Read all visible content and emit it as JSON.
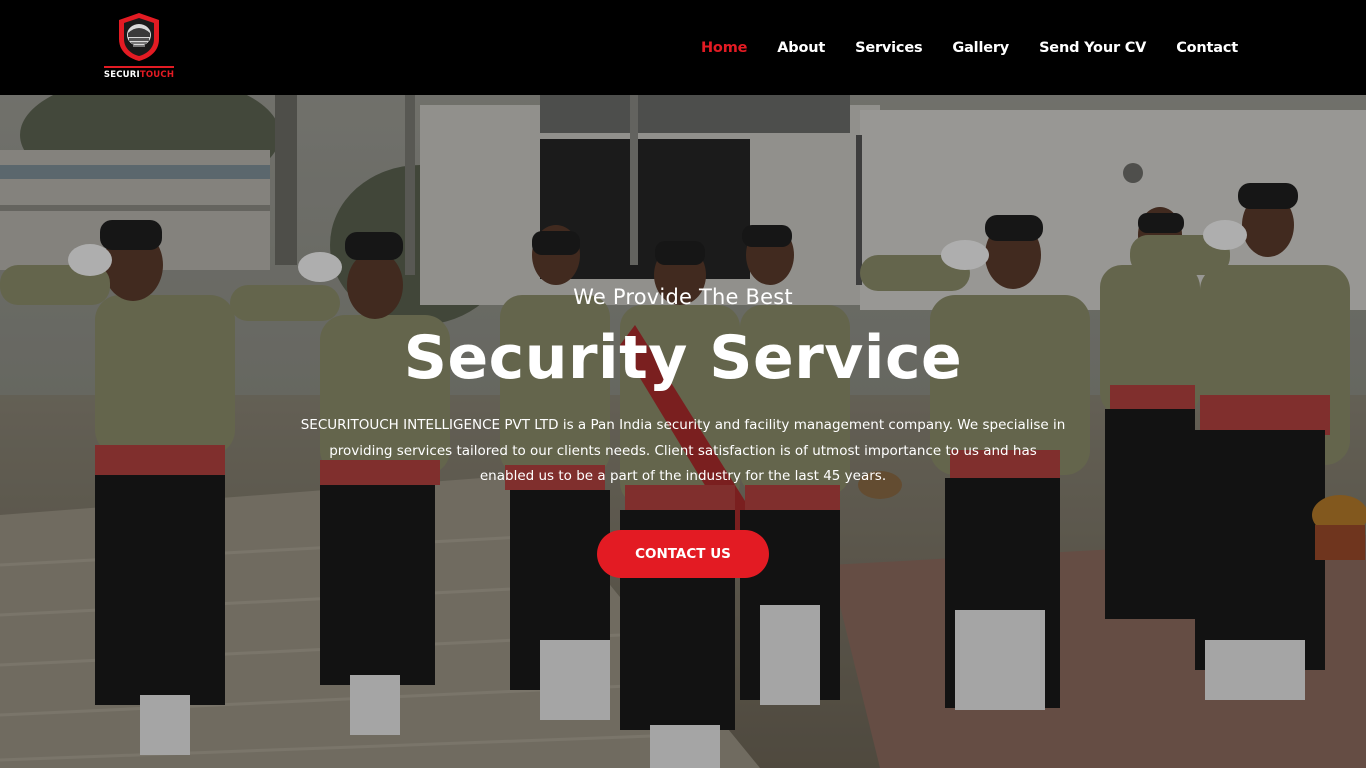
{
  "brand": {
    "logo_text_a": "SECURI",
    "logo_text_b": "TOUCH",
    "logo_icon": "shield-helmet-icon",
    "accent_color": "#e31b23"
  },
  "nav": {
    "items": [
      {
        "label": "Home",
        "active": true
      },
      {
        "label": "About",
        "active": false
      },
      {
        "label": "Services",
        "active": false
      },
      {
        "label": "Gallery",
        "active": false
      },
      {
        "label": "Send Your CV",
        "active": false
      },
      {
        "label": "Contact",
        "active": false
      }
    ]
  },
  "hero": {
    "subtitle": "We Provide The Best",
    "title": "Security Service",
    "description": "SECURITOUCH INTELLIGENCE PVT LTD is a Pan India security and facility management company. We specialise in providing services tailored to our clients needs. Client satisfaction is of utmost importance to us and has enabled us to be a part of the industry for the last 45 years.",
    "cta_label": "CONTACT US"
  }
}
